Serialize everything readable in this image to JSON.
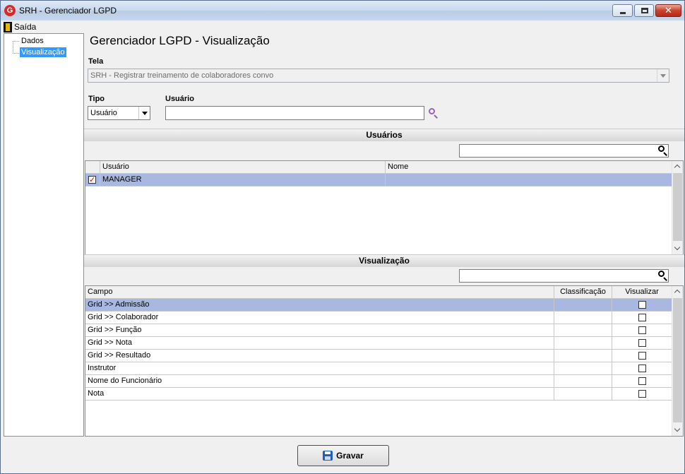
{
  "window": {
    "app_logo": "G",
    "title": "SRH - Gerenciador LGPD",
    "close_glyph": "✕"
  },
  "menu": {
    "exit_label": "Saída"
  },
  "tree": {
    "items": [
      {
        "label": "Dados",
        "selected": false
      },
      {
        "label": "Visualização",
        "selected": true
      }
    ]
  },
  "page": {
    "title": "Gerenciador LGPD - Visualização"
  },
  "form": {
    "tela_label": "Tela",
    "tela_value": "SRH - Registrar treinamento de colaboradores convo",
    "tipo_label": "Tipo",
    "tipo_value": "Usuário",
    "usuario_label": "Usuário",
    "usuario_value": ""
  },
  "users_section": {
    "title": "Usuários",
    "search_value": "",
    "columns": [
      "Usuário",
      "Nome"
    ],
    "rows": [
      {
        "checked": true,
        "usuario": "MANAGER",
        "nome": "",
        "selected": true
      }
    ]
  },
  "view_section": {
    "title": "Visualização",
    "search_value": "",
    "columns": [
      "Campo",
      "Classificação",
      "Visualizar"
    ],
    "rows": [
      {
        "campo": "Grid >> Admissão",
        "classificacao": "",
        "visualizar": false,
        "selected": true
      },
      {
        "campo": "Grid >> Colaborador",
        "classificacao": "",
        "visualizar": false,
        "selected": false
      },
      {
        "campo": "Grid >> Função",
        "classificacao": "",
        "visualizar": false,
        "selected": false
      },
      {
        "campo": "Grid >> Nota",
        "classificacao": "",
        "visualizar": false,
        "selected": false
      },
      {
        "campo": "Grid >> Resultado",
        "classificacao": "",
        "visualizar": false,
        "selected": false
      },
      {
        "campo": "Instrutor",
        "classificacao": "",
        "visualizar": false,
        "selected": false
      },
      {
        "campo": "Nome do Funcionário",
        "classificacao": "",
        "visualizar": false,
        "selected": false
      },
      {
        "campo": "Nota",
        "classificacao": "",
        "visualizar": false,
        "selected": false
      }
    ]
  },
  "footer": {
    "save_label": "Gravar"
  },
  "colors": {
    "selection_row": "#a8b8e0",
    "tree_selection": "#3399ff",
    "check_red": "#d40000",
    "lookup_purple": "#9b5fc0",
    "save_icon_blue": "#1f5fbf"
  }
}
